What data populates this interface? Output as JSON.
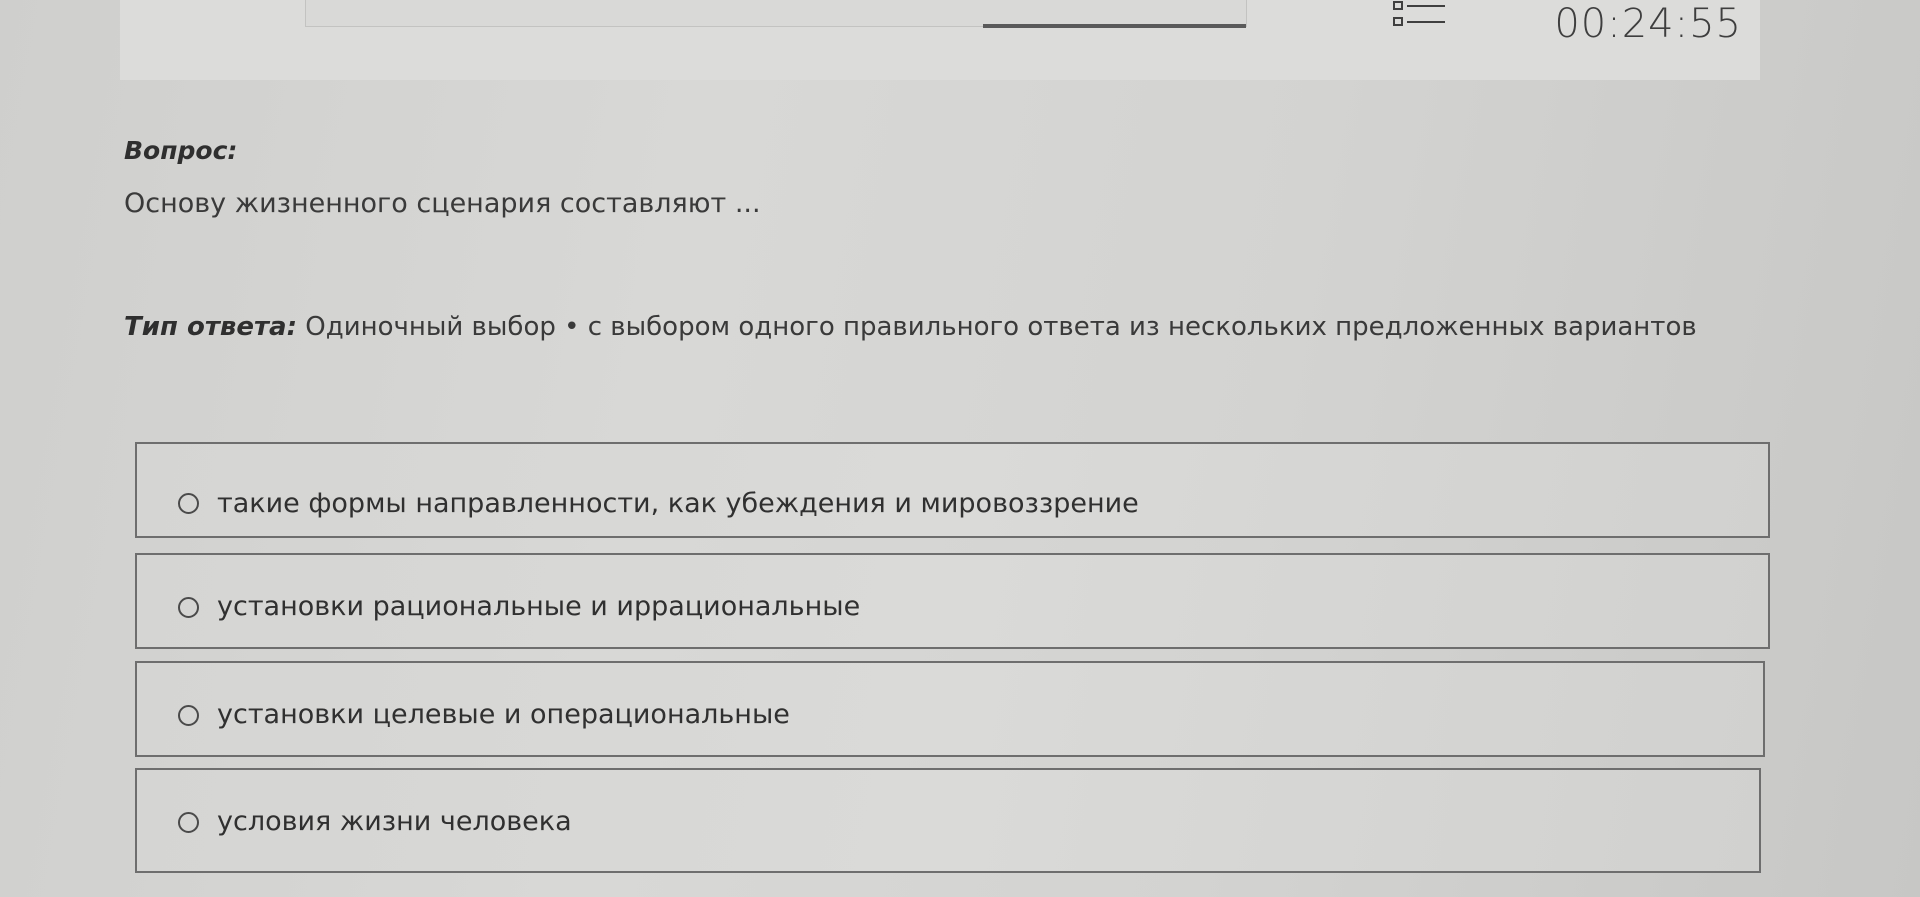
{
  "header": {
    "timer": "00:24:55",
    "progress_percent": 28,
    "question_list_icon": "question-list-icon"
  },
  "question": {
    "label": "Вопрос:",
    "text": "Основу жизненного сценария составляют ..."
  },
  "answer_type": {
    "label": "Тип ответа:",
    "value": " Одиночный выбор • с выбором одного правильного ответа из нескольких предложенных вариантов"
  },
  "options": [
    {
      "label": "такие формы направленности, как убеждения и мировоззрение",
      "selected": false
    },
    {
      "label": "установки рациональные и иррациональные",
      "selected": false
    },
    {
      "label": "установки целевые и операциональные",
      "selected": false
    },
    {
      "label": "условия жизни человека",
      "selected": false
    }
  ]
}
